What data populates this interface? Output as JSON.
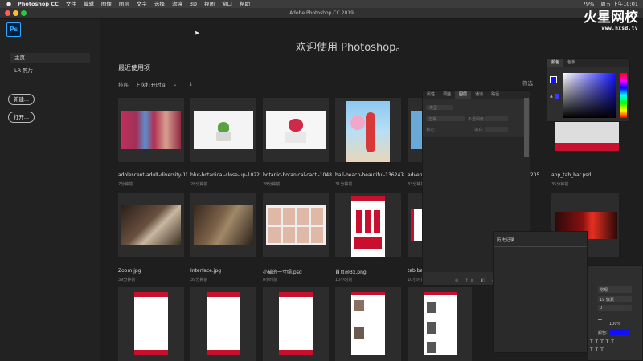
{
  "menubar": {
    "app": "Photoshop CC",
    "items": [
      "文件",
      "编辑",
      "图像",
      "图层",
      "文字",
      "选择",
      "滤镜",
      "3D",
      "视图",
      "窗口",
      "帮助"
    ],
    "right_status": [
      "79%",
      "周五 上午10:01"
    ]
  },
  "window": {
    "title": "Adobe Photoshop CC 2019"
  },
  "watermark": {
    "title": "火星网校",
    "url": "www.hxsd.tv"
  },
  "logo": "Ps",
  "nav": {
    "home": "主页",
    "lr": "LR 照片",
    "new_btn": "新建...",
    "open_btn": "打开..."
  },
  "welcome": "欢迎使用 Photoshop。",
  "recent": {
    "title": "最近使用项",
    "sort_label": "排序",
    "sort_value": "上次打开时间",
    "filter_label": "筛选"
  },
  "files": [
    {
      "name": "adolescent-adult-diversity-10...",
      "time": "7分钟前"
    },
    {
      "name": "blur-botanical-close-up-1022...",
      "time": "28分钟前"
    },
    {
      "name": "botanic-botanical-cacti-1048...",
      "time": "28分钟前"
    },
    {
      "name": "ball-beach-beautiful-1362478...",
      "time": "31分钟前"
    },
    {
      "name": "adven",
      "time": "33分钟前"
    },
    {
      "name": "1205...",
      "time": ""
    },
    {
      "name": "app_tab_bar.psd",
      "time": "35分钟前"
    },
    {
      "name": "Zoom.jpg",
      "time": "39分钟前"
    },
    {
      "name": "Interface.jpg",
      "time": "39分钟前"
    },
    {
      "name": "小猫的一寸照.psd",
      "time": "8小时前"
    },
    {
      "name": "首页@3x.png",
      "time": "10小时前"
    },
    {
      "name": "tab ba",
      "time": "10小时前"
    }
  ],
  "panels": {
    "layers_tabs": [
      "属性",
      "调整",
      "图层",
      "通道",
      "路径"
    ],
    "layers_kind": "类型",
    "layers_mode": "正常",
    "layers_opacity": "不透明度:",
    "layers_lock": "锁定:",
    "layers_fill": "填充:",
    "color_tabs": [
      "颜色",
      "色板"
    ],
    "history_title": "历史记录",
    "char_style": "常规",
    "char_size": "19 像素",
    "char_tracking": "0",
    "char_scale": "100%",
    "char_color_label": "颜色:"
  },
  "colors": {
    "accent": "#31a8ff",
    "red": "#c8102e",
    "fg_swatch": "#1010ff"
  }
}
